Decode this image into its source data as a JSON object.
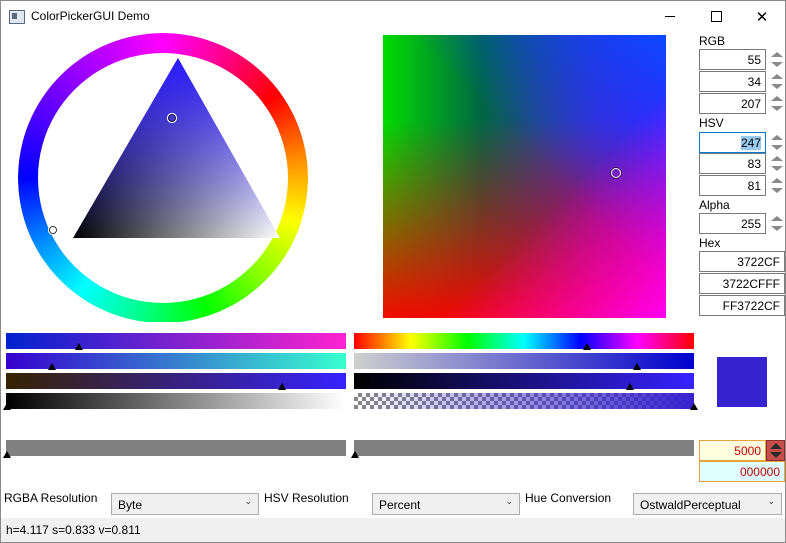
{
  "window": {
    "title": "ColorPickerGUI Demo"
  },
  "colors": {
    "current": "#3722CF"
  },
  "rgb": {
    "label": "RGB",
    "r": "55",
    "g": "34",
    "b": "207"
  },
  "hsv": {
    "label": "HSV",
    "h": "247",
    "s": "83",
    "v": "81"
  },
  "alpha": {
    "label": "Alpha",
    "value": "255"
  },
  "hex": {
    "label": "Hex",
    "rgb": "3722CF",
    "rgba": "3722CFFF",
    "argb": "FF3722CF"
  },
  "extra": {
    "number": "5000",
    "hex": "000000"
  },
  "settings": {
    "rgba_resolution_label": "RGBA Resolution",
    "rgba_resolution_value": "Byte",
    "hsv_resolution_label": "HSV Resolution",
    "hsv_resolution_value": "Percent",
    "hue_conversion_label": "Hue Conversion",
    "hue_conversion_value": "OstwaldPerceptual"
  },
  "status": {
    "text": "h=4.117 s=0.833 v=0.811"
  },
  "icons": {
    "minimize": "minimize-icon",
    "maximize": "maximize-icon",
    "close": "close-icon",
    "spin": "spin-arrows-icon",
    "dropdown": "chevron-down-icon"
  }
}
